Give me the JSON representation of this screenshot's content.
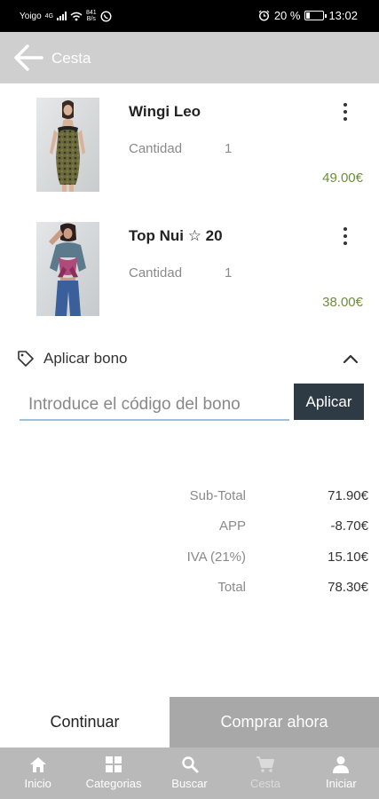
{
  "status_bar": {
    "carrier": "Yoigo",
    "network": "4G",
    "speed_top": "841",
    "speed_bottom": "B/s",
    "battery": "20 %",
    "time": "13:02"
  },
  "header": {
    "title": "Cesta"
  },
  "cart": {
    "items": [
      {
        "name": "Wingi Leo",
        "qty_label": "Cantidad",
        "qty": "1",
        "price": "49.00€"
      },
      {
        "name": "Top Nui ☆ 20",
        "qty_label": "Cantidad",
        "qty": "1",
        "price": "38.00€"
      }
    ]
  },
  "coupon": {
    "label": "Aplicar bono",
    "placeholder": "Introduce el código del bono",
    "apply_label": "Aplicar"
  },
  "totals": [
    {
      "label": "Sub-Total",
      "value": "71.90€"
    },
    {
      "label": "APP",
      "value": "-8.70€"
    },
    {
      "label": "IVA (21%)",
      "value": "15.10€"
    },
    {
      "label": "Total",
      "value": "78.30€"
    }
  ],
  "actions": {
    "continue_label": "Continuar",
    "buy_label": "Comprar ahora"
  },
  "nav": [
    {
      "label": "Inicio",
      "icon": "home-icon"
    },
    {
      "label": "Categorias",
      "icon": "grid-icon"
    },
    {
      "label": "Buscar",
      "icon": "search-icon"
    },
    {
      "label": "Cesta",
      "icon": "cart-icon"
    },
    {
      "label": "Iniciar",
      "icon": "user-icon"
    }
  ],
  "colors": {
    "price": "#6e8d3a",
    "header": "#cfcfcf",
    "apply_button": "#2f3b44",
    "buy_button": "#a8a8a8",
    "navbar": "#b9b9b9"
  }
}
